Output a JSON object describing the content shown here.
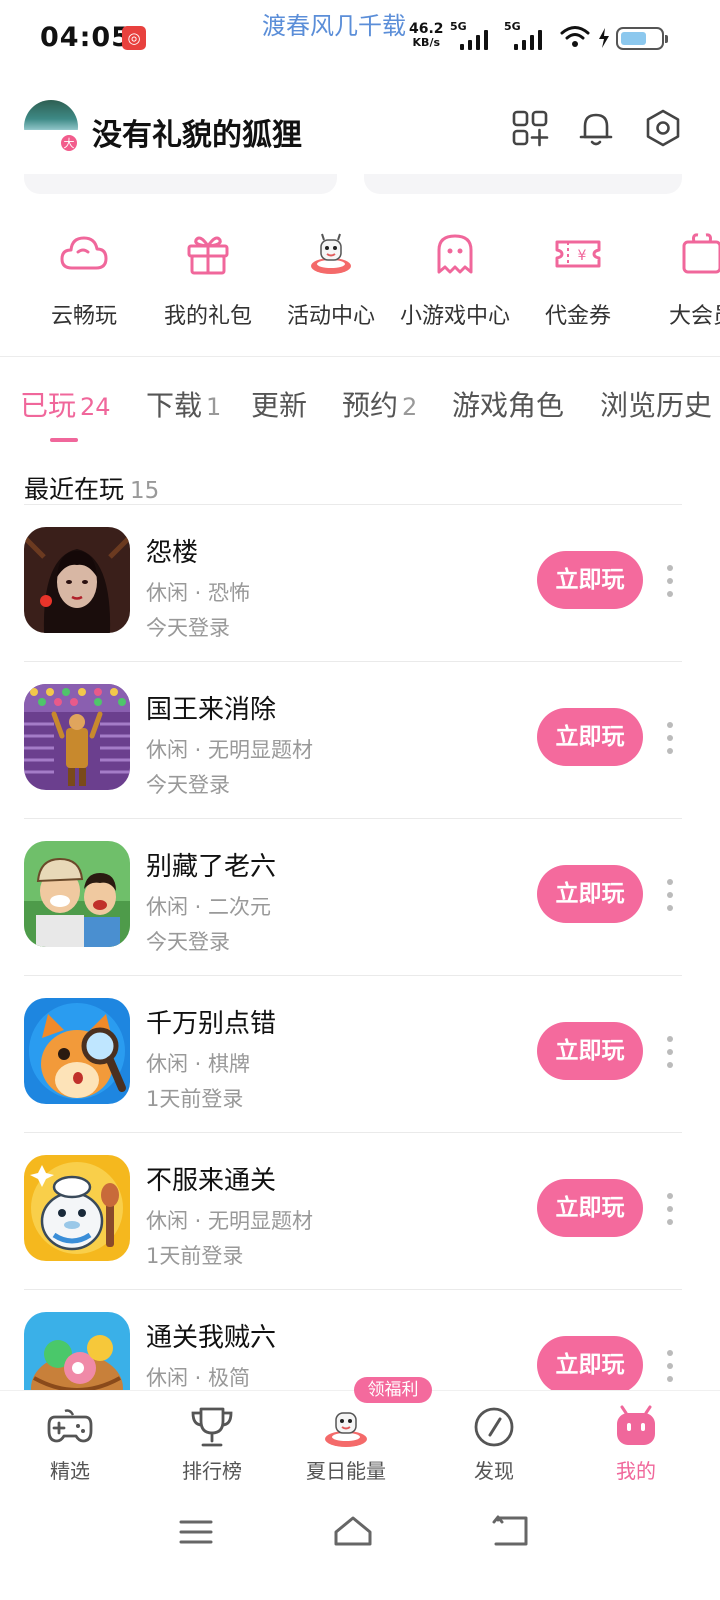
{
  "status_bar": {
    "time": "04:05",
    "song": "渡春风几千载",
    "net_speed": "46.2",
    "net_unit": "KB/s",
    "sim1": "5G",
    "sim2": "5G",
    "battery_level": 0.65
  },
  "profile": {
    "username": "没有礼貌的狐狸",
    "avatar_badge": "大"
  },
  "quick_menu": [
    {
      "label": "云畅玩",
      "icon": "cloud-icon"
    },
    {
      "label": "我的礼包",
      "icon": "gift-icon"
    },
    {
      "label": "活动中心",
      "icon": "mascot-boat-icon"
    },
    {
      "label": "小游戏中心",
      "icon": "ghost-icon"
    },
    {
      "label": "代金券",
      "icon": "voucher-icon"
    },
    {
      "label": "大会员",
      "icon": "vip-icon"
    }
  ],
  "tabs": [
    {
      "label": "已玩",
      "count": "24"
    },
    {
      "label": "下载",
      "count": "1"
    },
    {
      "label": "更新",
      "count": ""
    },
    {
      "label": "预约",
      "count": "2"
    },
    {
      "label": "游戏角色",
      "count": ""
    },
    {
      "label": "浏览历史",
      "count": ""
    }
  ],
  "section": {
    "title": "最近在玩",
    "count": "15"
  },
  "games": [
    {
      "name": "怨楼",
      "tags": "休闲 · 恐怖",
      "last_login": "今天登录",
      "button": "立即玩"
    },
    {
      "name": "国王来消除",
      "tags": "休闲 · 无明显题材",
      "last_login": "今天登录",
      "button": "立即玩"
    },
    {
      "name": "别藏了老六",
      "tags": "休闲 · 二次元",
      "last_login": "今天登录",
      "button": "立即玩"
    },
    {
      "name": "千万别点错",
      "tags": "休闲 · 棋牌",
      "last_login": "1天前登录",
      "button": "立即玩"
    },
    {
      "name": "不服来通关",
      "tags": "休闲 · 无明显题材",
      "last_login": "1天前登录",
      "button": "立即玩"
    },
    {
      "name": "通关我贼六",
      "tags": "休闲 · 极简",
      "last_login": "",
      "button": "立即玩"
    }
  ],
  "bottom_nav": [
    {
      "label": "精选",
      "icon": "gamepad-icon"
    },
    {
      "label": "排行榜",
      "icon": "trophy-icon"
    },
    {
      "label": "夏日能量",
      "icon": "summer-mascot-icon"
    },
    {
      "label": "发现",
      "icon": "compass-icon"
    },
    {
      "label": "我的",
      "icon": "profile-mascot-icon"
    }
  ],
  "promo_badge": "领福利",
  "colors": {
    "accent": "#f46a9d",
    "tab_active": "#f0679b",
    "song_text": "#5b8ed8"
  }
}
